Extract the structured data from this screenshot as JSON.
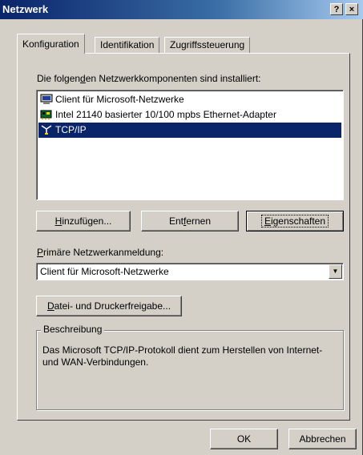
{
  "window": {
    "title": "Netzwerk",
    "help_glyph": "?",
    "close_glyph": "×"
  },
  "tabs": [
    {
      "label": "Konfiguration",
      "active": true
    },
    {
      "label": "Identifikation",
      "active": false
    },
    {
      "label": "Zugriffssteuerung",
      "active": false
    }
  ],
  "components": {
    "heading_pre": "Die folgen",
    "heading_key": "d",
    "heading_post": "en Netzwerkkomponenten sind installiert:",
    "items": [
      {
        "label": "Client für Microsoft-Netzwerke",
        "icon": "client-icon",
        "selected": false
      },
      {
        "label": "Intel 21140 basierter 10/100 mpbs Ethernet-Adapter",
        "icon": "network-adapter-icon",
        "selected": false
      },
      {
        "label": "TCP/IP",
        "icon": "protocol-icon",
        "selected": true
      }
    ]
  },
  "buttons": {
    "add": {
      "key": "H",
      "rest": "inzufügen..."
    },
    "remove": {
      "pre": "Ent",
      "key": "f",
      "post": "ernen"
    },
    "properties": {
      "key": "E",
      "rest": "igenschaften"
    },
    "file_print_sharing": {
      "key": "D",
      "rest": "atei- und Druckerfreigabe..."
    },
    "ok": "OK",
    "cancel": "Abbrechen"
  },
  "logon": {
    "label_key": "P",
    "label_rest": "rimäre Netzwerkanmeldung:",
    "selected": "Client für Microsoft-Netzwerke"
  },
  "description": {
    "legend": "Beschreibung",
    "text": "Das Microsoft TCP/IP-Protokoll dient zum Herstellen von Internet- und WAN-Verbindungen."
  },
  "colors": {
    "title_bar": "#0a246a",
    "selection": "#0a246a",
    "dialog_face": "#d4d0c8"
  }
}
